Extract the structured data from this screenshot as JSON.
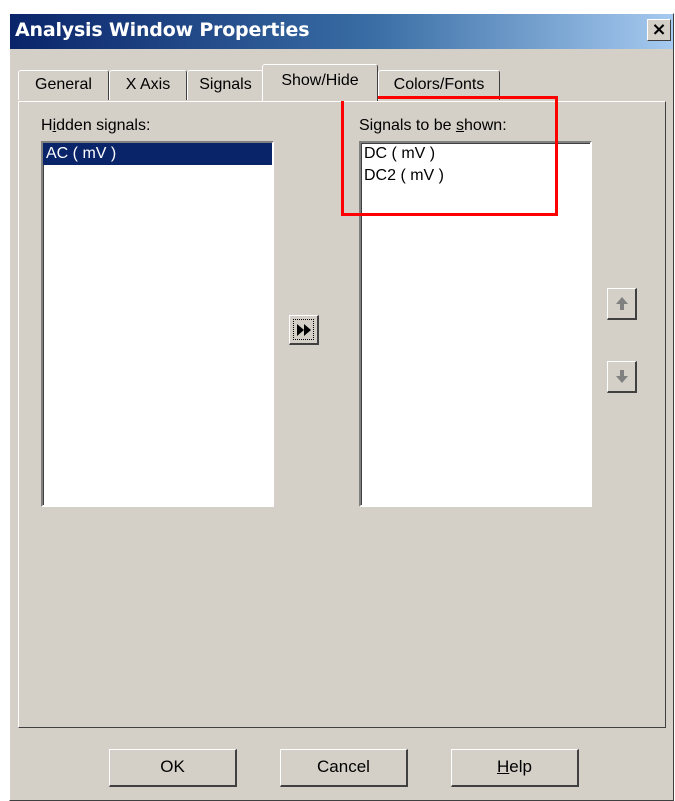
{
  "window": {
    "title": "Analysis Window Properties",
    "close_glyph": "×"
  },
  "tabs": [
    {
      "label": "General",
      "active": false
    },
    {
      "label": "X Axis",
      "active": false
    },
    {
      "label": "Signals",
      "active": false
    },
    {
      "label": "Show/Hide",
      "active": true
    },
    {
      "label": "Colors/Fonts",
      "active": false
    }
  ],
  "hidden": {
    "label_pre": "H",
    "label_mnemonic": "i",
    "label_post": "dden signals:",
    "items": [
      {
        "text": "AC ( mV )",
        "selected": true
      }
    ]
  },
  "shown": {
    "label_pre": "Signals to be ",
    "label_mnemonic": "s",
    "label_post": "hown:",
    "items": [
      {
        "text": "DC ( mV )",
        "selected": false
      },
      {
        "text": "DC2 ( mV )",
        "selected": false
      }
    ]
  },
  "icons": {
    "move": "fast-forward-icon",
    "up": "arrow-up-icon",
    "down": "arrow-down-icon"
  },
  "buttons": {
    "ok": "OK",
    "cancel": "Cancel",
    "help_mnemonic": "H",
    "help_rest": "elp"
  },
  "colors": {
    "title_bar": "#0a246a",
    "face": "#d4d0c8",
    "selection": "#0a246a",
    "annotation": "#ff0000"
  }
}
